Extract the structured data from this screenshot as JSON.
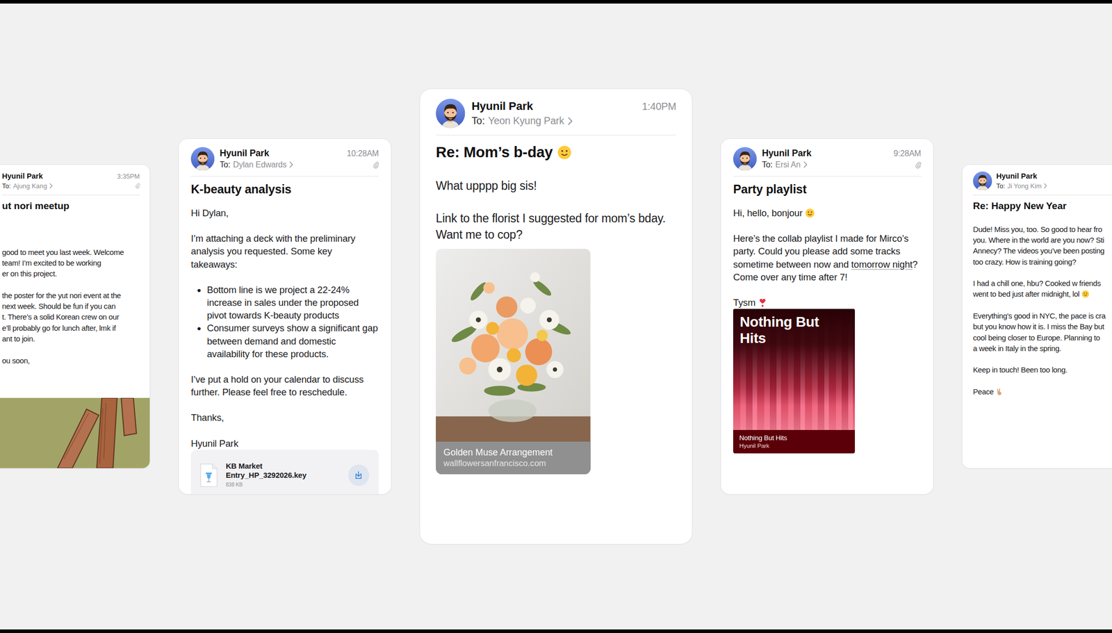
{
  "cards": [
    {
      "kind": "left",
      "sender": "Hyunil Park",
      "to_label": "To:",
      "recipient": "Ajung Kang",
      "time": "3:35PM",
      "clip": true,
      "subject": "ut nori meetup",
      "blocks": [
        {
          "kind": "lines",
          "lines": [
            {
              "text": "good to meet you last week. Welcome"
            },
            {
              "text": "team! I’m excited to be working"
            },
            {
              "text": "er on this project."
            }
          ]
        },
        {
          "kind": "lines",
          "lines": [
            {
              "text": "the poster for the yut nori event at the"
            },
            {
              "text": "next week. Should be fun if you can"
            },
            {
              "text": "t. There’s a solid Korean crew on our"
            },
            {
              "text": "e’ll probably go for lunch after, lmk if"
            },
            {
              "text": "ant to join."
            }
          ]
        },
        {
          "kind": "lines",
          "lines": [
            {
              "text": "ou soon,"
            }
          ]
        }
      ],
      "media": {
        "kind": "poster"
      }
    },
    {
      "kind": "side",
      "sender": "Hyunil Park",
      "to_label": "To:",
      "recipient": "Dylan Edwards",
      "time": "10:28AM",
      "clip": true,
      "subject": "K-beauty analysis",
      "blocks": [
        {
          "kind": "para",
          "segments": [
            {
              "text": "Hi Dylan,",
              "link": false
            }
          ]
        },
        {
          "kind": "para",
          "segments": [
            {
              "text": "I’m attaching a deck with the preliminary analysis you requested. Some key takeaways:",
              "link": false
            }
          ]
        },
        {
          "kind": "bullets",
          "items": [
            "Bottom line is we project a 22-24% increase in sales under the proposed pivot towards K-beauty products",
            "Consumer surveys show a significant gap between demand and domestic availability for these products."
          ]
        },
        {
          "kind": "para",
          "segments": [
            {
              "text": "I’ve put a hold on your calendar to discuss further. Please feel free to reschedule.",
              "link": false
            }
          ]
        },
        {
          "kind": "para",
          "segments": [
            {
              "text": "Thanks,",
              "link": false
            }
          ]
        },
        {
          "kind": "para",
          "segments": [
            {
              "text": "Hyunil Park",
              "link": false
            }
          ]
        }
      ],
      "media": {
        "kind": "file",
        "name": "KB Market Entry_HP_3292026.key",
        "size": "838 KB"
      }
    },
    {
      "kind": "main",
      "sender": "Hyunil Park",
      "to_label": "To:",
      "recipient": "Yeon Kyung Park",
      "time": "1:40PM",
      "clip": false,
      "subject": "Re: Mom’s b-day",
      "subject_emoji": "face",
      "blocks": [
        {
          "kind": "para",
          "segments": [
            {
              "text": "What upppp big sis!",
              "link": false
            }
          ]
        },
        {
          "kind": "para",
          "segments": [
            {
              "text": "Link to the florist I suggested for mom’s bday. Want me to cop?",
              "link": false
            }
          ]
        }
      ],
      "media": {
        "kind": "link",
        "title": "Golden Muse Arrangement",
        "domain": "wallflowersanfrancisco.com"
      }
    },
    {
      "kind": "side",
      "sender": "Hyunil Park",
      "to_label": "To:",
      "recipient": "Ersi An",
      "time": "9:28AM",
      "clip": true,
      "subject": "Party playlist",
      "blocks": [
        {
          "kind": "para",
          "segments": [
            {
              "text": "Hi, hello, bonjour",
              "link": false
            }
          ],
          "emoji": "face"
        },
        {
          "kind": "para",
          "segments": [
            {
              "text": "Here’s the collab playlist I made for Mirco’s party. Could you please add some tracks sometime between now and ",
              "link": false
            },
            {
              "text": "tomorrow night",
              "link": true
            },
            {
              "text": "? Come over any time after 7!",
              "link": false
            }
          ]
        },
        {
          "kind": "para",
          "segments": [
            {
              "text": "Tysm",
              "link": false
            }
          ],
          "emoji": "heart"
        }
      ],
      "media": {
        "kind": "playlist",
        "cover_title": "Nothing But Hits",
        "name": "Nothing But Hits",
        "owner": "Hyunil Park"
      }
    },
    {
      "kind": "right",
      "sender": "Hyunil Park",
      "to_label": "To:",
      "recipient": "Ji Yong Kim",
      "subject": "Re: Happy New Year",
      "blocks": [
        {
          "kind": "lines",
          "lines": [
            {
              "text": "Dude! Miss you, too. So good to hear fro"
            },
            {
              "text": "you. Where in the world are you now? Sti"
            },
            {
              "text": "Annecy? The videos you’ve been posting"
            },
            {
              "text": "too crazy. How is training going?"
            }
          ]
        },
        {
          "kind": "lines",
          "lines": [
            {
              "text": "I had a chill one, hbu? Cooked w friends"
            },
            {
              "text": "went to bed just after midnight, lol",
              "emoji": "face"
            }
          ]
        },
        {
          "kind": "lines",
          "lines": [
            {
              "text": "Everything’s good in NYC, the pace is cra"
            },
            {
              "text": "but you know how it is. I miss the Bay but"
            },
            {
              "text": "cool being closer to Europe. Planning to"
            },
            {
              "text": "a week in Italy in the spring."
            }
          ]
        },
        {
          "kind": "lines",
          "lines": [
            {
              "text": "Keep in touch! Been too long."
            }
          ]
        },
        {
          "kind": "lines",
          "lines": [
            {
              "text": "Peace",
              "emoji": "hand"
            }
          ]
        }
      ]
    }
  ]
}
